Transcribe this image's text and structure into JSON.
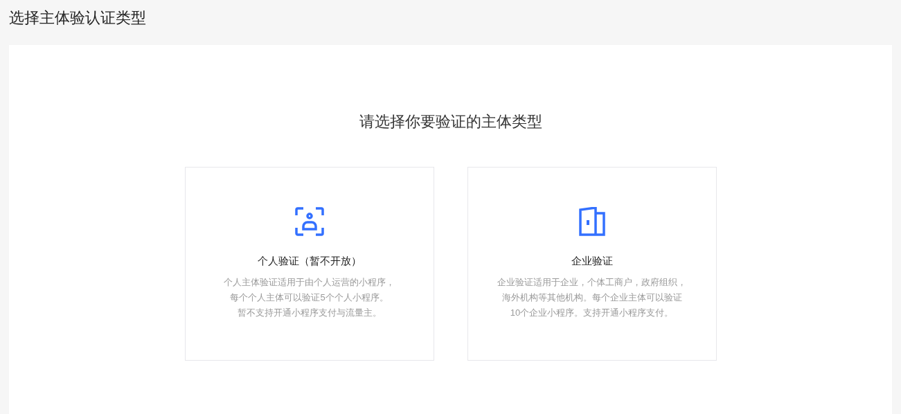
{
  "page_title": "选择主体验认证类型",
  "heading": "请选择你要验证的主体类型",
  "cards": [
    {
      "kind": "person",
      "title": "个人验证（暂不开放）",
      "description": [
        "个人主体验证适用于由个人运营的小程序，",
        "每个个人主体可以验证5个个人小程序。",
        "暂不支持开通小程序支付与流量主。"
      ]
    },
    {
      "kind": "building",
      "title": "企业验证",
      "description": [
        "企业验证适用于企业，个体工商户，政府组织，",
        "海外机构等其他机构。每个企业主体可以验证",
        "10个企业小程序。支持开通小程序支付。"
      ]
    }
  ]
}
